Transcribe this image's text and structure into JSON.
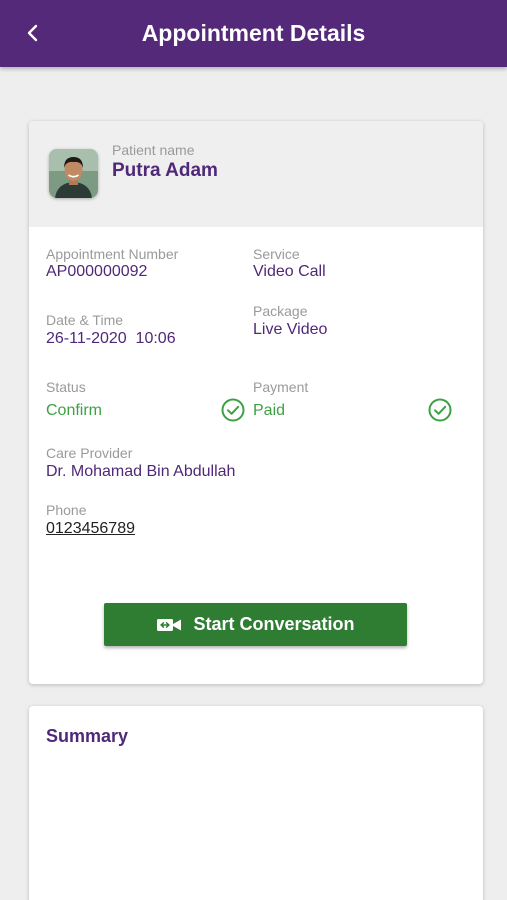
{
  "header": {
    "title": "Appointment Details",
    "back_icon": "chevron-left-icon"
  },
  "patient": {
    "label": "Patient name",
    "name": "Putra Adam"
  },
  "details": {
    "appointment_number": {
      "label": "Appointment Number",
      "value": "AP000000092"
    },
    "service": {
      "label": "Service",
      "value": "Video Call"
    },
    "date_time": {
      "label": "Date & Time",
      "value": "26-11-2020  10:06"
    },
    "package": {
      "label": "Package",
      "value": "Live Video"
    },
    "status": {
      "label": "Status",
      "value": "Confirm"
    },
    "payment": {
      "label": "Payment",
      "value": "Paid"
    },
    "care_provider": {
      "label": "Care Provider",
      "value": "Dr. Mohamad Bin Abdullah"
    },
    "phone": {
      "label": "Phone",
      "value": "0123456789"
    }
  },
  "actions": {
    "start_label": "Start Conversation",
    "start_icon": "video-call-icon"
  },
  "summary": {
    "title": "Summary"
  },
  "colors": {
    "primary": "#55297a",
    "accent_text": "#4f2878",
    "success": "#3da045",
    "button": "#2e7d32"
  }
}
